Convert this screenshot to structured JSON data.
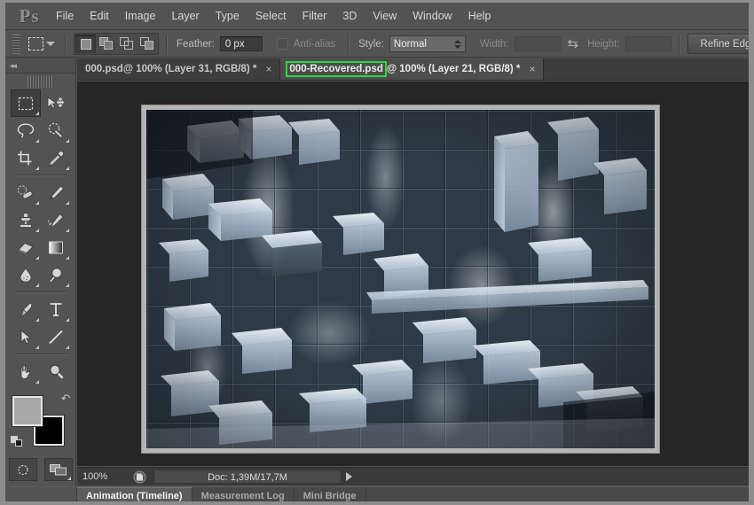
{
  "app": {
    "name": "Adobe Photoshop",
    "logo_text": "Ps"
  },
  "menubar": {
    "items": [
      {
        "label": "File"
      },
      {
        "label": "Edit"
      },
      {
        "label": "Image"
      },
      {
        "label": "Layer"
      },
      {
        "label": "Type"
      },
      {
        "label": "Select"
      },
      {
        "label": "Filter"
      },
      {
        "label": "3D"
      },
      {
        "label": "View"
      },
      {
        "label": "Window"
      },
      {
        "label": "Help"
      }
    ]
  },
  "options_bar": {
    "tool_preset_icon": "rectangular-marquee-icon",
    "selection_modes": [
      {
        "name": "new-selection",
        "active": true
      },
      {
        "name": "add-to-selection",
        "active": false
      },
      {
        "name": "subtract-from-selection",
        "active": false
      },
      {
        "name": "intersect-with-selection",
        "active": false
      }
    ],
    "feather_label": "Feather:",
    "feather_value": "0 px",
    "antialias_label": "Anti-alias",
    "antialias_checked": false,
    "style_label": "Style:",
    "style_value": "Normal",
    "width_label": "Width:",
    "width_value": "",
    "swap_icon": "swap-arrows-icon",
    "height_label": "Height:",
    "height_value": "",
    "refine_edge_label": "Refine Edge..."
  },
  "toolbox": {
    "collapse_icon": "collapse-double-arrow-icon",
    "tools": [
      {
        "name": "rectangular-marquee-tool",
        "active": true,
        "hasFlyout": true
      },
      {
        "name": "move-tool",
        "active": false,
        "hasFlyout": false
      },
      {
        "name": "lasso-tool",
        "active": false,
        "hasFlyout": true
      },
      {
        "name": "quick-selection-tool",
        "active": false,
        "hasFlyout": true
      },
      {
        "name": "crop-tool",
        "active": false,
        "hasFlyout": true
      },
      {
        "name": "eyedropper-tool",
        "active": false,
        "hasFlyout": true
      },
      {
        "name": "spot-healing-brush-tool",
        "active": false,
        "hasFlyout": true
      },
      {
        "name": "brush-tool",
        "active": false,
        "hasFlyout": true
      },
      {
        "name": "clone-stamp-tool",
        "active": false,
        "hasFlyout": true
      },
      {
        "name": "history-brush-tool",
        "active": false,
        "hasFlyout": true
      },
      {
        "name": "eraser-tool",
        "active": false,
        "hasFlyout": true
      },
      {
        "name": "gradient-tool",
        "active": false,
        "hasFlyout": true
      },
      {
        "name": "blur-tool",
        "active": false,
        "hasFlyout": true
      },
      {
        "name": "dodge-tool",
        "active": false,
        "hasFlyout": true
      },
      {
        "name": "pen-tool",
        "active": false,
        "hasFlyout": true
      },
      {
        "name": "horizontal-type-tool",
        "active": false,
        "hasFlyout": true
      },
      {
        "name": "path-selection-tool",
        "active": false,
        "hasFlyout": true
      },
      {
        "name": "line-tool",
        "active": false,
        "hasFlyout": true
      },
      {
        "name": "hand-tool",
        "active": false,
        "hasFlyout": true
      },
      {
        "name": "zoom-tool",
        "active": false,
        "hasFlyout": false
      }
    ],
    "colors": {
      "foreground": "#a8a8a8",
      "background": "#000000",
      "swap_icon": "swap-colors-icon",
      "default_icon": "default-colors-icon"
    },
    "quick_mask_icon": "quick-mask-icon",
    "screen_mode_icon": "screen-mode-icon"
  },
  "document_tabs": [
    {
      "name": "tab-000-psd",
      "filename": "000.psd",
      "rest": " @ 100% (Layer 31, RGB/8) *",
      "close_label": "×",
      "active": false,
      "highlighted": false
    },
    {
      "name": "tab-000-recovered-psd",
      "filename": "000-Recovered.psd",
      "rest": " @ 100% (Layer 21, RGB/8) *",
      "close_label": "×",
      "active": true,
      "highlighted": true
    }
  ],
  "annotation": {
    "highlight_color": "#2ad83e",
    "target": "000-Recovered.psd"
  },
  "status_bar": {
    "zoom_level": "100%",
    "doc_icon": "document-thumbnail-icon",
    "doc_info": "Doc: 1,39M/17,7M",
    "arrow_icon": "play-arrow-icon"
  },
  "panel_tabs": [
    {
      "name": "panel-tab-animation",
      "label": "Animation (Timeline)",
      "active": true
    },
    {
      "name": "panel-tab-measurement-log",
      "label": "Measurement Log",
      "active": false
    },
    {
      "name": "panel-tab-mini-bridge",
      "label": "Mini Bridge",
      "active": false
    }
  ],
  "canvas": {
    "artwork_description": "abstract blue-grey 3d cube grid with cloudy smoke texture",
    "palette": {
      "dark": "#1c232b",
      "mid": "#6c7f92",
      "light": "#c6d4e2",
      "highlight": "#eef4fa",
      "face": "#9fb0c2",
      "shadow": "#4a5866"
    }
  }
}
